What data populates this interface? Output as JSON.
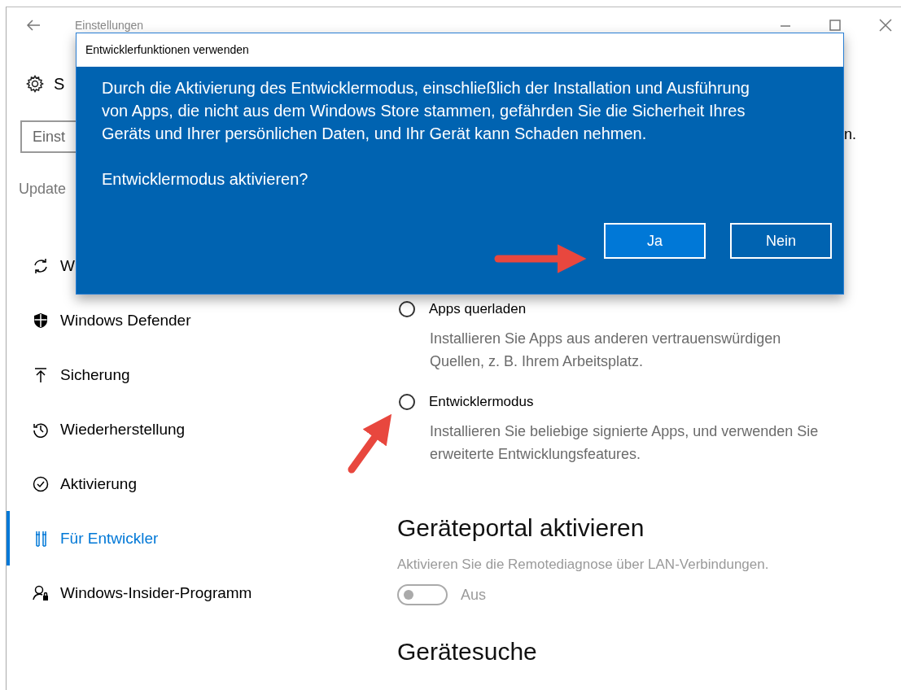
{
  "window": {
    "title": "Einstellungen"
  },
  "sidebar": {
    "header": "S",
    "search": {
      "placeholder": "Einst"
    },
    "section": "Update",
    "items": [
      {
        "label": "W",
        "selected": false
      },
      {
        "label": "Windows Defender",
        "selected": false
      },
      {
        "label": "Sicherung",
        "selected": false
      },
      {
        "label": "Wiederherstellung",
        "selected": false
      },
      {
        "label": "Aktivierung",
        "selected": false
      },
      {
        "label": "Für Entwickler",
        "selected": true
      },
      {
        "label": "Windows-Insider-Programm",
        "selected": false
      }
    ]
  },
  "content": {
    "fragment": "n.",
    "options": [
      {
        "label": "Apps querladen",
        "description": "Installieren Sie Apps aus anderen vertrauenswürdigen Quellen, z. B. Ihrem Arbeitsplatz.",
        "selected": false
      },
      {
        "label": "Entwicklermodus",
        "description": "Installieren Sie beliebige signierte Apps, und verwenden Sie erweiterte Entwicklungsfeatures.",
        "selected": false
      }
    ],
    "portal": {
      "heading": "Geräteportal aktivieren",
      "description": "Aktivieren Sie die Remotediagnose über LAN-Verbindungen.",
      "toggle": {
        "on": false,
        "label": "Aus"
      }
    },
    "next_heading": "Gerätesuche"
  },
  "dialog": {
    "title": "Entwicklerfunktionen verwenden",
    "message": "Durch die Aktivierung des Entwicklermodus, einschließlich der Installation und Ausführung von Apps, die nicht aus dem Windows Store stammen, gefährden Sie die Sicherheit Ihres Geräts und Ihrer persönlichen Daten, und Ihr Gerät kann Schaden nehmen.",
    "question": "Entwicklermodus aktivieren?",
    "buttons": [
      {
        "label": "Ja",
        "default": true
      },
      {
        "label": "Nein",
        "default": false
      }
    ]
  }
}
